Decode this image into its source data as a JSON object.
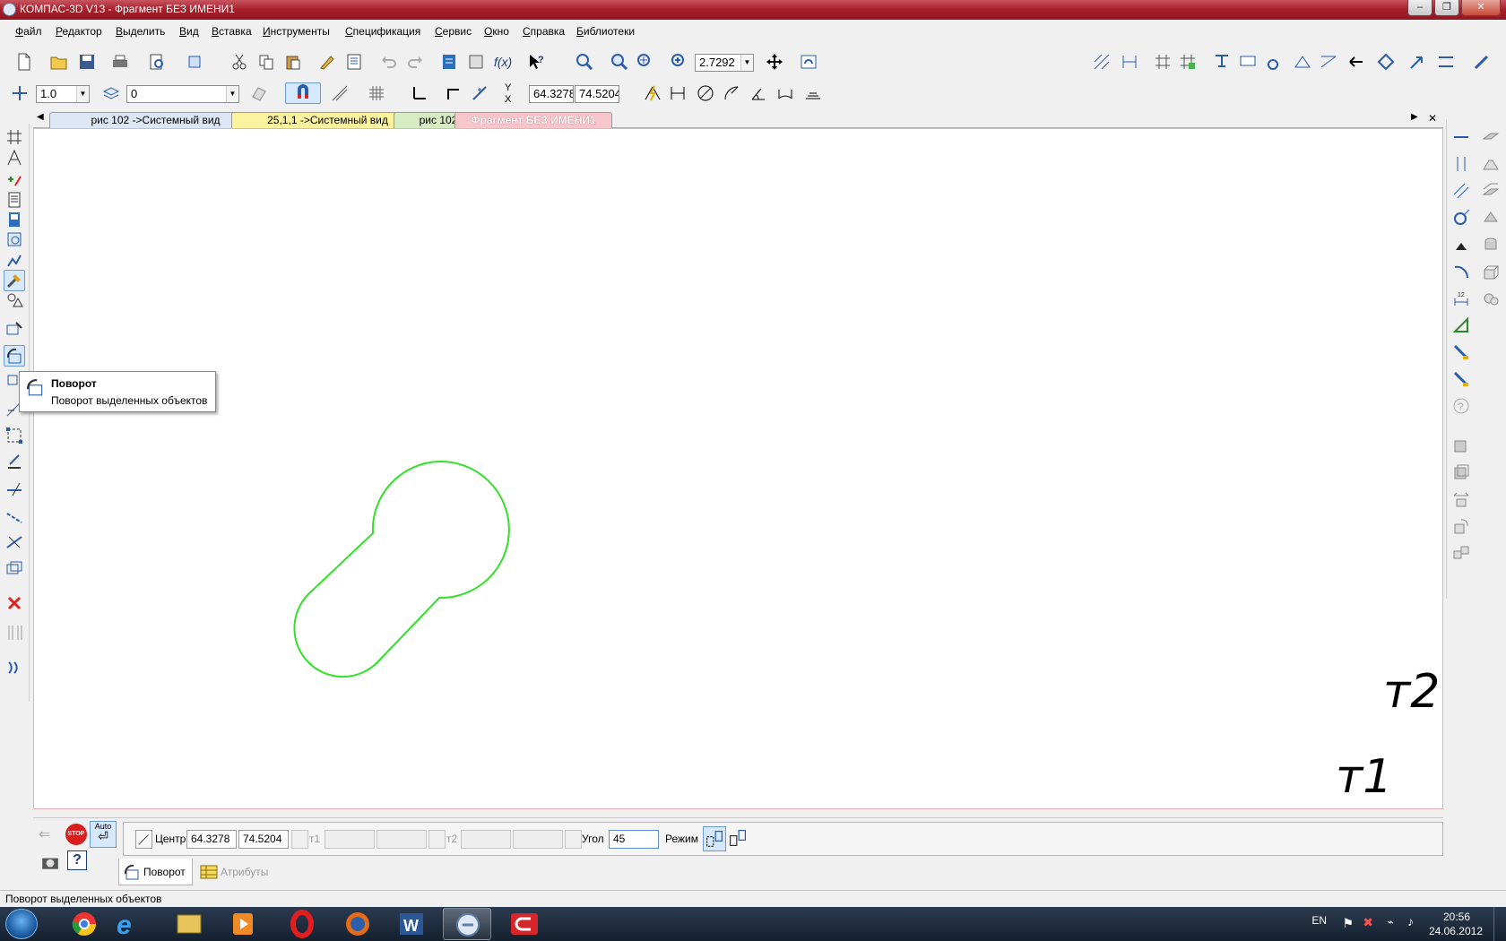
{
  "window": {
    "title": "КОМПАС-3D V13 - Фрагмент БЕЗ ИМЕНИ1"
  },
  "menu": [
    "Файл",
    "Редактор",
    "Выделить",
    "Вид",
    "Вставка",
    "Инструменты",
    "Спецификация",
    "Сервис",
    "Окно",
    "Справка",
    "Библиотеки"
  ],
  "toolbar": {
    "zoom_value": "2.7292",
    "step_value": "1.0",
    "layer_value": "0",
    "coord_x": "64.3278",
    "coord_y": "74.5204",
    "coord_axis_y": "Y",
    "coord_axis_x": "X"
  },
  "tabs": [
    {
      "label": "рис 102 ->Системный вид",
      "color": "#dce6f5"
    },
    {
      "label": "25,1,1 ->Системный вид",
      "color": "#fbf3a0"
    },
    {
      "label": "рис 102",
      "color": "#d8ecc4"
    },
    {
      "label": "Фрагмент БЕЗ ИМЕНИ1",
      "color": "#f7c6cc"
    }
  ],
  "canvas": {
    "label_t1": "т1",
    "label_t2": "т2",
    "contour_color": "#33e02a"
  },
  "tooltip": {
    "title": "Поворот",
    "description": "Поворот выделенных объектов"
  },
  "property_panel": {
    "auto_label": "Auto",
    "stop_label": "STOP",
    "center_label": "Центр",
    "center_x": "64.3278",
    "center_y": "74.5204",
    "t1_label": "т1",
    "t2_label": "т2",
    "angle_label": "Угол",
    "angle_value": "45",
    "mode_label": "Режим",
    "tab_rotate": "Поворот",
    "tab_attributes": "Атрибуты"
  },
  "statusbar": {
    "text": "Поворот выделенных объектов"
  },
  "taskbar": {
    "lang": "EN",
    "time": "20:56",
    "date": "24.06.2012"
  }
}
